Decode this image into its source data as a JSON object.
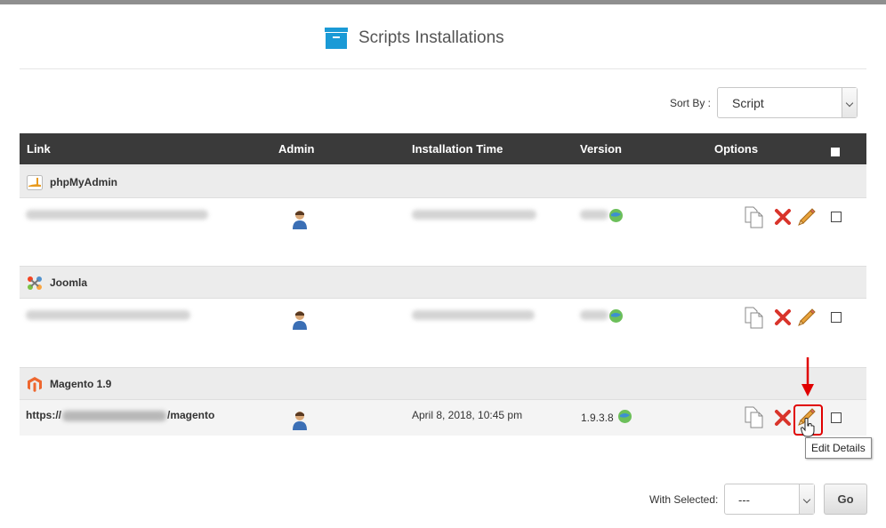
{
  "header": {
    "title": "Scripts Installations",
    "icon": "archive-box-icon",
    "icon_color": "#1a9ad6"
  },
  "sort": {
    "label": "Sort By :",
    "selected": "Script"
  },
  "table": {
    "columns": [
      "Link",
      "Admin",
      "Installation Time",
      "Version",
      "Options"
    ],
    "header_bg": "#3a3a3a",
    "groups": [
      {
        "name": "phpMyAdmin",
        "icon": "phpmyadmin-icon",
        "row": {
          "link": "",
          "installation_time": "",
          "version": "",
          "blurred": true
        }
      },
      {
        "name": "Joomla",
        "icon": "joomla-icon",
        "row": {
          "link": "",
          "installation_time": "",
          "version": "",
          "blurred": true
        }
      },
      {
        "name": "Magento 1.9",
        "icon": "magento-icon",
        "row": {
          "link_prefix": "https://",
          "link_suffix": "/magento",
          "installation_time": "April 8, 2018, 10:45 pm",
          "version": "1.9.3.8",
          "blurred": false
        }
      }
    ]
  },
  "tooltip": "Edit Details",
  "with_selected": {
    "label": "With Selected:",
    "selected": "---",
    "go_label": "Go"
  },
  "colors": {
    "highlight": "#e00000",
    "delete": "#d9342b",
    "edit": "#e8a33c"
  }
}
